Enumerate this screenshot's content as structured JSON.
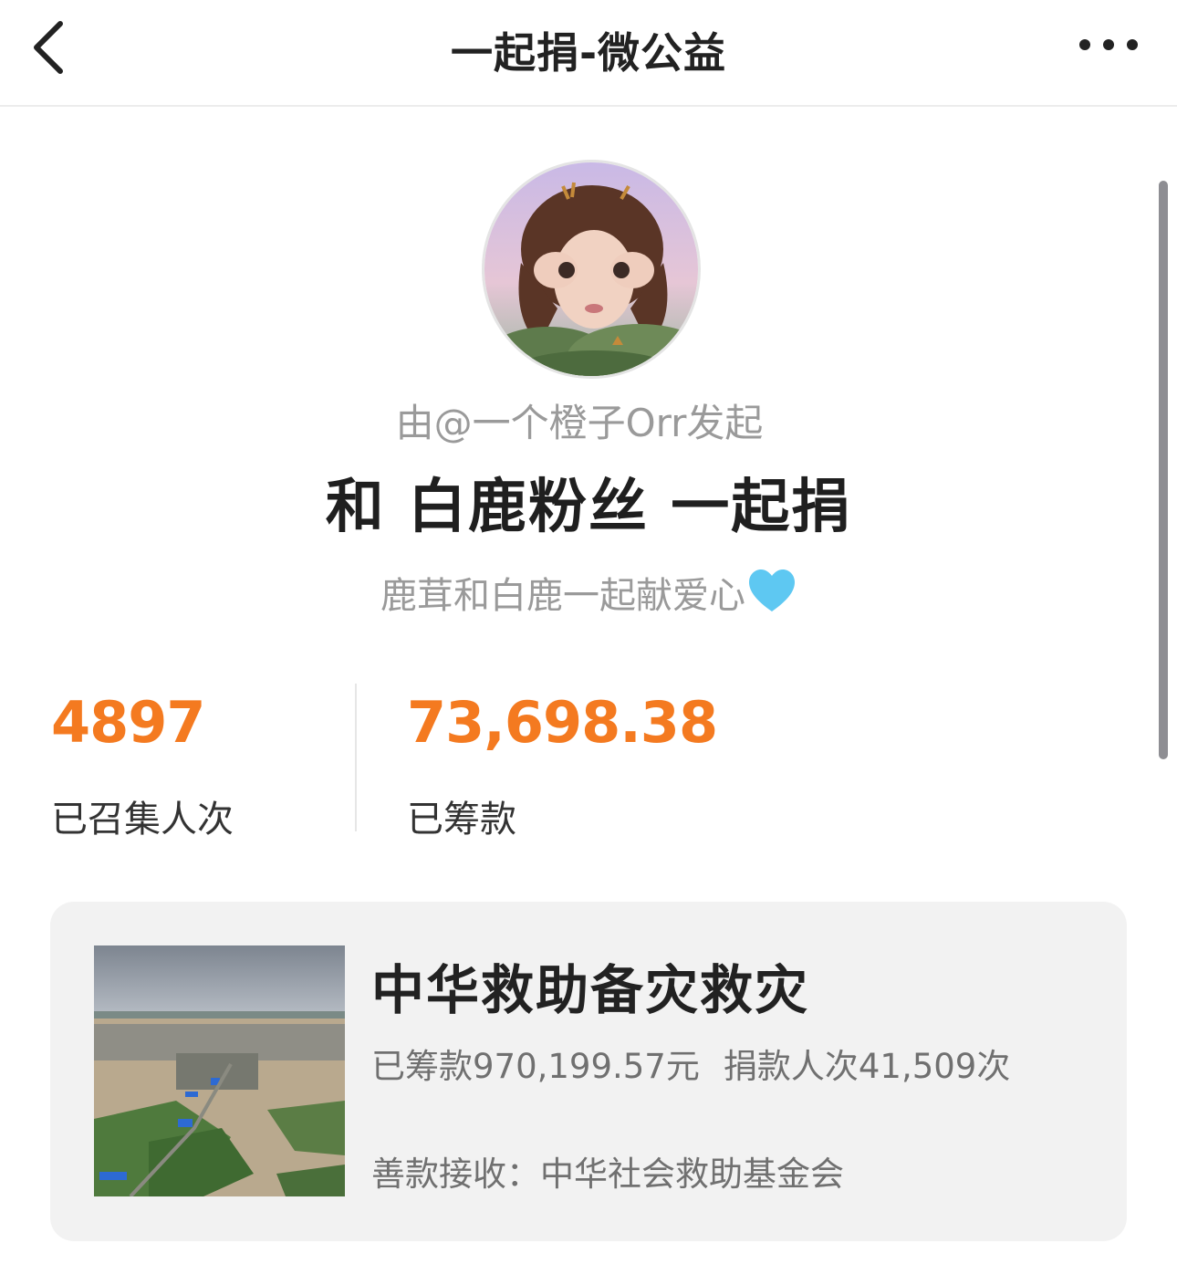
{
  "nav": {
    "back_icon": "chevron-left-icon",
    "title": "一起捐-微公益",
    "more_icon": "more-dots-icon"
  },
  "campaign": {
    "initiator": "由@一个橙子Orr发起",
    "headline": "和 白鹿粉丝 一起捐",
    "slogan": "鹿茸和白鹿一起献爱心",
    "slogan_emoji": "blue-heart-icon"
  },
  "stats": {
    "participants_value": "4897",
    "participants_label": "已召集人次",
    "raised_value": "73,698.38",
    "raised_label": "已筹款"
  },
  "project": {
    "title": "中华救助备灾救灾",
    "raised": "已筹款970,199.57元",
    "donors": "捐款人次41,509次",
    "recipient": "善款接收：中华社会救助基金会"
  },
  "colors": {
    "accent": "#f47a20",
    "heart": "#5ec8f2",
    "card_bg": "#f2f2f2"
  }
}
